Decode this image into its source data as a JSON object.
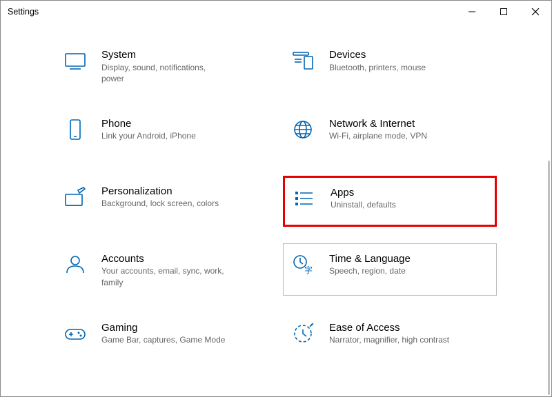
{
  "window": {
    "title": "Settings"
  },
  "tiles": [
    {
      "name": "system",
      "icon": "monitor-icon",
      "title": "System",
      "sub": "Display, sound, notifications, power"
    },
    {
      "name": "devices",
      "icon": "devices-icon",
      "title": "Devices",
      "sub": "Bluetooth, printers, mouse"
    },
    {
      "name": "phone",
      "icon": "phone-icon",
      "title": "Phone",
      "sub": "Link your Android, iPhone"
    },
    {
      "name": "network",
      "icon": "globe-icon",
      "title": "Network & Internet",
      "sub": "Wi-Fi, airplane mode, VPN"
    },
    {
      "name": "personalization",
      "icon": "paint-icon",
      "title": "Personalization",
      "sub": "Background, lock screen, colors"
    },
    {
      "name": "apps",
      "icon": "apps-icon",
      "title": "Apps",
      "sub": "Uninstall, defaults",
      "highlight": true
    },
    {
      "name": "accounts",
      "icon": "person-icon",
      "title": "Accounts",
      "sub": "Your accounts, email, sync, work, family"
    },
    {
      "name": "time-language",
      "icon": "timelang-icon",
      "title": "Time & Language",
      "sub": "Speech, region, date",
      "hovered": true
    },
    {
      "name": "gaming",
      "icon": "gamepad-icon",
      "title": "Gaming",
      "sub": "Game Bar, captures, Game Mode"
    },
    {
      "name": "ease-of-access",
      "icon": "ease-icon",
      "title": "Ease of Access",
      "sub": "Narrator, magnifier, high contrast"
    }
  ]
}
